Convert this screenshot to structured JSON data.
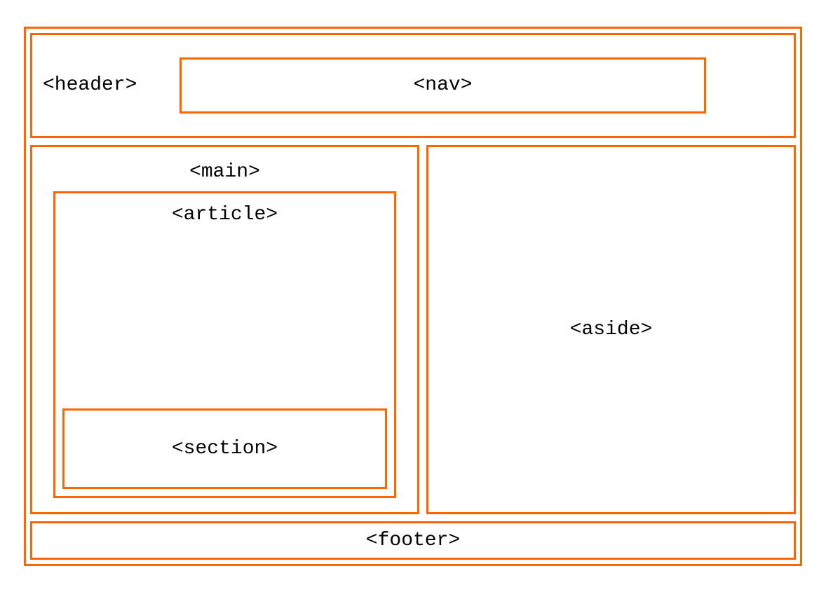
{
  "labels": {
    "header": "<header>",
    "nav": "<nav>",
    "main": "<main>",
    "article": "<article>",
    "section": "<section>",
    "aside": "<aside>",
    "footer": "<footer>"
  }
}
